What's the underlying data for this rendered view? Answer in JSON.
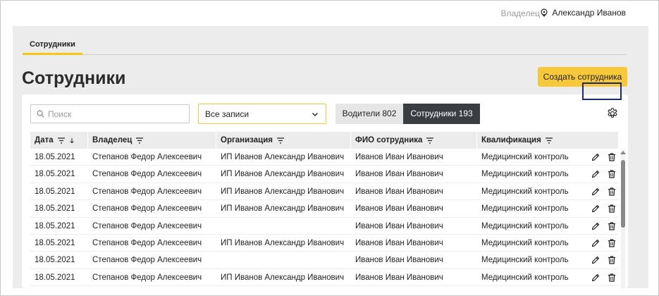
{
  "header": {
    "role": "Владелец",
    "user_name": "Александр Иванов"
  },
  "tabs": [
    {
      "label": "Сотрудники",
      "active": true
    }
  ],
  "page": {
    "title": "Сотрудники",
    "create_button": "Создать сотрудника"
  },
  "filters": {
    "search_placeholder": "Поиск",
    "select_value": "Все записи",
    "segments": [
      {
        "label": "Водители 802",
        "active": false
      },
      {
        "label": "Сотрудники 193",
        "active": true
      }
    ]
  },
  "table": {
    "columns": [
      "Дата",
      "Владелец",
      "Организация",
      "ФИО сотрудника",
      "Квалификация"
    ],
    "rows": [
      [
        "18.05.2021",
        "Степанов Федор Алексеевич",
        "ИП Иванов Александр Иванович",
        "Иванов Иван Иванович",
        "Медицинский контроль"
      ],
      [
        "18.05.2021",
        "Степанов Федор Алексеевич",
        "ИП Иванов Александр Иванович",
        "Иванов Иван Иванович",
        "Медицинский контроль"
      ],
      [
        "18.05.2021",
        "Степанов Федор Алексеевич",
        "ИП Иванов Александр Иванович",
        "Иванов Иван Иванович",
        "Медицинский контроль"
      ],
      [
        "18.05.2021",
        "Степанов Федор Алексеевич",
        "ИП Иванов Александр Иванович",
        "Иванов Иван Иванович",
        "Медицинский контроль"
      ],
      [
        "18.05.2021",
        "Степанов Федор Алексеевич",
        "",
        "Иванов Иван Иванович",
        "Медицинский контроль"
      ],
      [
        "18.05.2021",
        "Степанов Федор Алексеевич",
        "ИП Иванов Александр Иванович",
        "Иванов Иван Иванович",
        "Медицинский контроль"
      ],
      [
        "18.05.2021",
        "Степанов Федор Алексеевич",
        "",
        "Иванов Иван Иванович",
        "Медицинский контроль"
      ],
      [
        "18.05.2021",
        "Степанов Федор Алексеевич",
        "ИП Иванов Александр Иванович",
        "Иванов Иван Иванович",
        "Медицинский контроль"
      ]
    ]
  },
  "colors": {
    "accent": "#f6c83a",
    "active_segment": "#3a3d42",
    "highlight": "#1a2a6c"
  },
  "icons": {
    "user": "location-pin-icon",
    "search": "search-icon",
    "dropdown": "chevron-down-icon",
    "settings": "gear-icon",
    "filter": "filter-icon",
    "sort": "sort-down-arrow-icon",
    "edit": "pencil-icon",
    "delete": "trash-icon"
  }
}
